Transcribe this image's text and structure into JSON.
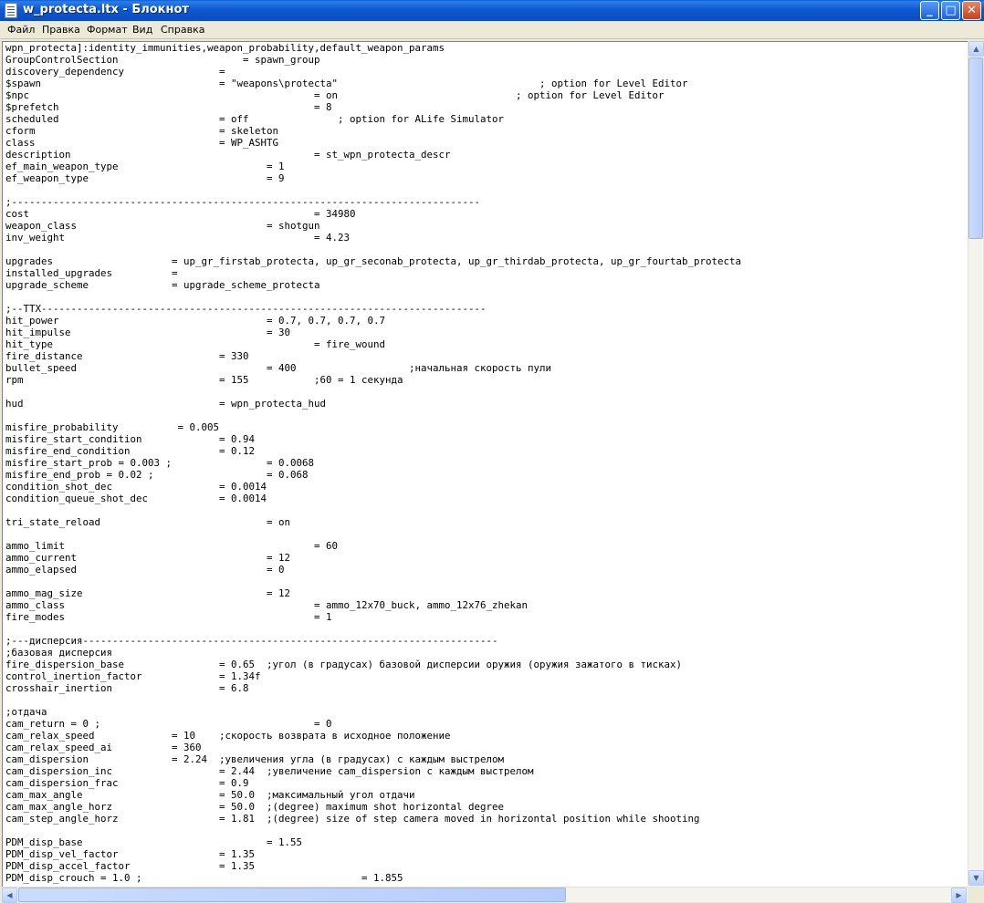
{
  "window": {
    "title": "w_protecta.ltx - Блокнот",
    "buttons": {
      "minimize": "_",
      "maximize": "□",
      "close": "✕"
    }
  },
  "menu": [
    "Файл",
    "Правка",
    "Формат",
    "Вид",
    "Справка"
  ],
  "scrollbar": {
    "up": "▲",
    "down": "▼",
    "left": "◀",
    "right": "▶"
  },
  "editor": {
    "text": "wpn_protecta]:identity_immunities,weapon_probability,default_weapon_params\nGroupControlSection                     = spawn_group\ndiscovery_dependency                =\n$spawn                              = \"weapons\\protecta\"                                  ; option for Level Editor\n$npc                                                = on                              ; option for Level Editor\n$prefetch                                           = 8\nscheduled                           = off               ; option for ALife Simulator\ncform                               = skeleton\nclass                               = WP_ASHTG\ndescription                                         = st_wpn_protecta_descr\nef_main_weapon_type                         = 1\nef_weapon_type                              = 9\n\n;-------------------------------------------------------------------------------\ncost                                                = 34980\nweapon_class                                = shotgun\ninv_weight                                          = 4.23\n\nupgrades                    = up_gr_firstab_protecta, up_gr_seconab_protecta, up_gr_thirdab_protecta, up_gr_fourtab_protecta\ninstalled_upgrades          =\nupgrade_scheme              = upgrade_scheme_protecta\n\n;--TTX---------------------------------------------------------------------------\nhit_power                                   = 0.7, 0.7, 0.7, 0.7\nhit_impulse                                 = 30\nhit_type                                            = fire_wound\nfire_distance                       = 330\nbullet_speed                                = 400                   ;начальная скорость пули\nrpm                                 = 155           ;60 = 1 секунда\n\nhud                                 = wpn_protecta_hud\n\nmisfire_probability          = 0.005\nmisfire_start_condition             = 0.94\nmisfire_end_condition               = 0.12\nmisfire_start_prob = 0.003 ;                = 0.0068\nmisfire_end_prob = 0.02 ;                   = 0.068\ncondition_shot_dec                  = 0.0014\ncondition_queue_shot_dec            = 0.0014\n\ntri_state_reload                            = on\n\nammo_limit                                          = 60\nammo_current                                = 12\nammo_elapsed                                = 0\n\nammo_mag_size                               = 12\nammo_class                                          = ammo_12x70_buck, ammo_12x76_zhekan\nfire_modes                                          = 1\n\n;---дисперсия----------------------------------------------------------------------\n;базовая дисперсия\nfire_dispersion_base                = 0.65  ;угол (в градусах) базовой дисперсии оружия (оружия зажатого в тисках)\ncontrol_inertion_factor             = 1.34f\ncrosshair_inertion                  = 6.8\n\n;отдача\ncam_return = 0 ;                                    = 0\ncam_relax_speed             = 10    ;скорость возврата в исходное положение\ncam_relax_speed_ai          = 360\ncam_dispersion              = 2.24  ;увеличения угла (в градусах) с каждым выстрелом\ncam_dispersion_inc                  = 2.44  ;увеличение cam_dispersion с каждым выстрелом\ncam_dispersion_frac                 = 0.9\ncam_max_angle                       = 50.0  ;максимальный угол отдачи\ncam_max_angle_horz                  = 50.0  ;(degree) maximum shot horizontal degree\ncam_step_angle_horz                 = 1.81  ;(degree) size of step camera moved in horizontal position while shooting\n\nPDM_disp_base                               = 1.55\nPDM_disp_vel_factor                 = 1.35\nPDM_disp_accel_factor               = 1.35\nPDM_disp_crouch = 1.0 ;                                     = 1.855"
  }
}
